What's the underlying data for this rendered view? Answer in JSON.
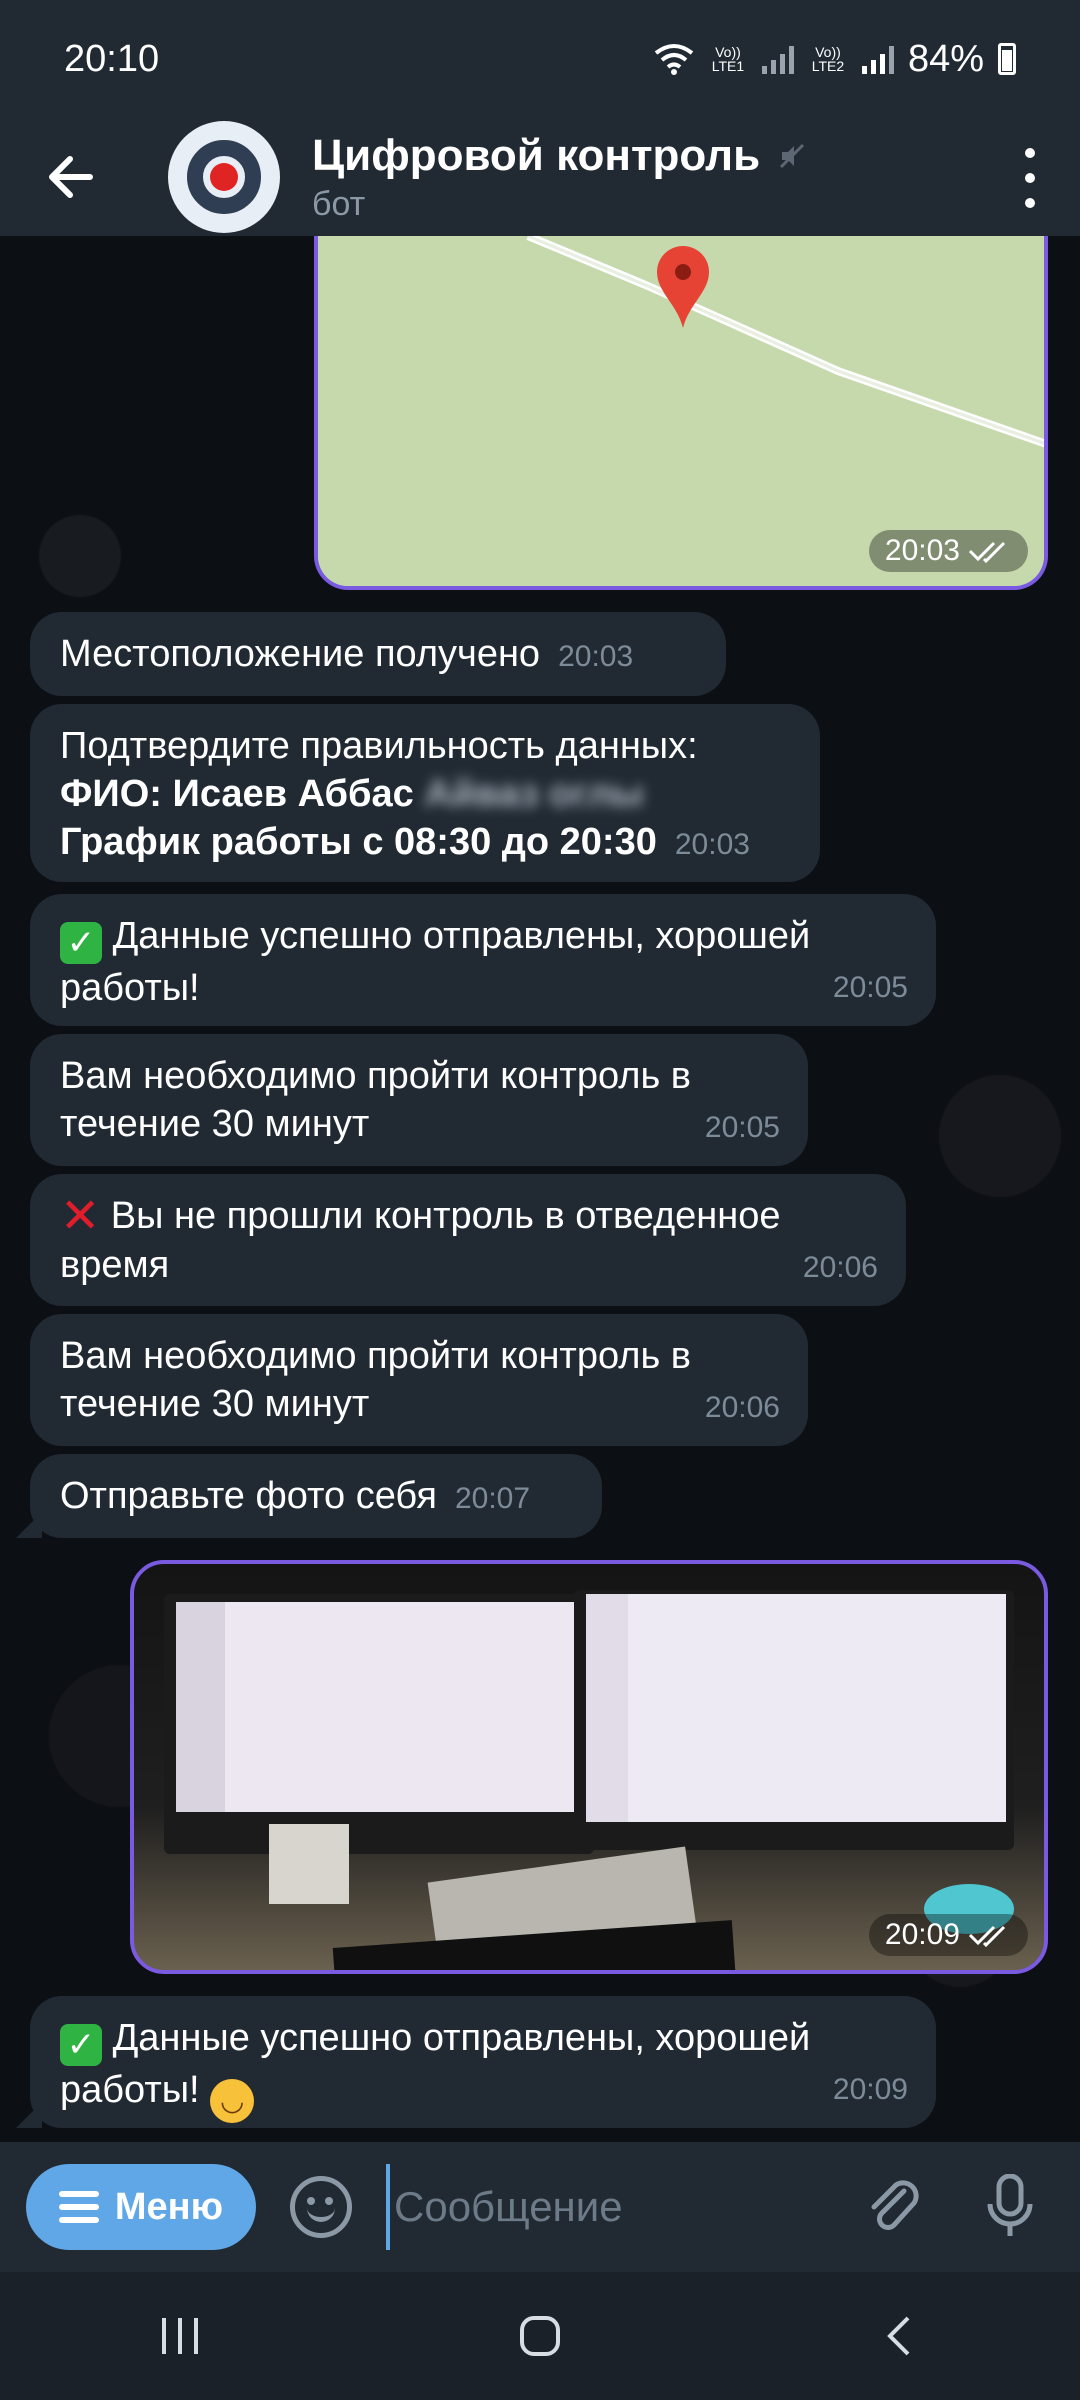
{
  "status_bar": {
    "time": "20:10",
    "sim1": "Vo)) LTE1",
    "sim2": "Vo)) LTE2",
    "battery": "84%",
    "battery_level": 0.84
  },
  "header": {
    "title": "Цифровой контроль",
    "subtitle": "бот"
  },
  "map": {
    "time": "20:03"
  },
  "messages": [
    {
      "text": "Местоположение получено",
      "time": "20:03"
    },
    {
      "line1": "Подтвердите правильность данных:",
      "fio_label": "ФИО: Исаев Аббас",
      "fio_hidden": "Айваз оглы",
      "schedule": "График работы с 08:30 до 20:30",
      "time": "20:03"
    },
    {
      "text": "Данные успешно отправлены, хорошей работы!",
      "time": "20:05"
    },
    {
      "text": "Вам необходимо пройти контроль в течение 30 минут",
      "time": "20:05"
    },
    {
      "text": "Вы не прошли контроль в отведенное время",
      "time": "20:06"
    },
    {
      "text": "Вам необходимо пройти контроль в течение 30 минут",
      "time": "20:06"
    },
    {
      "text": "Отправьте фото себя",
      "time": "20:07"
    },
    {
      "text": "Данные успешно отправлены, хорошей работы!",
      "time": "20:09"
    }
  ],
  "photo": {
    "time": "20:09"
  },
  "input": {
    "menu_label": "Меню",
    "placeholder": "Сообщение"
  },
  "icons": {
    "back": "arrow-left-icon",
    "mute": "muted-icon",
    "more": "more-vertical-icon",
    "check": "check-mark-emoji",
    "cross": "cross-mark-emoji",
    "smile": "smiling-face-emoji",
    "attach": "paperclip-icon",
    "mic": "microphone-icon",
    "read": "double-check-icon"
  },
  "colors": {
    "accent": "#5fa7e6",
    "bubble": "#212a33",
    "outgoing_border": "#7a5ae0"
  }
}
